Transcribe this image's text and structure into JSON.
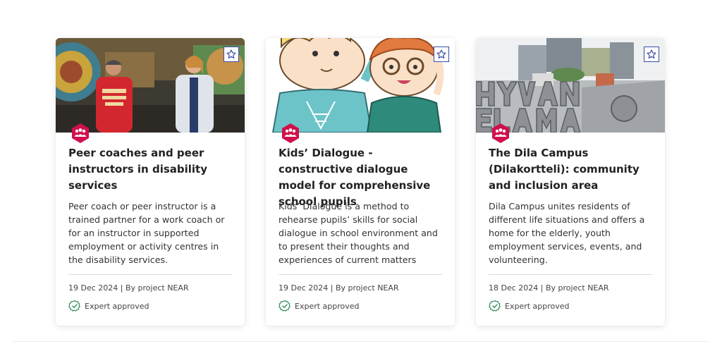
{
  "cards": [
    {
      "title": "Peer coaches and peer instructors in disability services",
      "description": "Peer coach or peer instructor is a trained partner for a work coach or for an instructor in supported employment or activity centres in the disability services.",
      "meta": "19 Dec 2024 | By project NEAR",
      "badge": "Expert approved",
      "favorite_icon": "star-outline-icon",
      "category_icon": "people-group-icon"
    },
    {
      "title": "Kids’ Dialogue - constructive dialogue model for comprehensive school pupils",
      "description": "Kids’ Dialogue is a method to rehearse pupils’ skills for social dialogue in school environment and to present their thoughts and experiences of current matters",
      "meta": "19 Dec 2024 | By project NEAR",
      "badge": "Expert approved",
      "favorite_icon": "star-outline-icon",
      "category_icon": "people-group-icon"
    },
    {
      "title": "The Dila Campus (Dilakortteli): community and inclusion area",
      "description": "Dila Campus unites residents of different life situations and offers a home for the elderly, youth employment services, events, and volunteering.",
      "meta": "18 Dec 2024 | By project NEAR",
      "badge": "Expert approved",
      "favorite_icon": "star-outline-icon",
      "category_icon": "people-group-icon"
    }
  ],
  "colors": {
    "accent_red": "#d0104c",
    "star_blue": "#3a4ea6",
    "approved_green": "#2e8b57"
  }
}
